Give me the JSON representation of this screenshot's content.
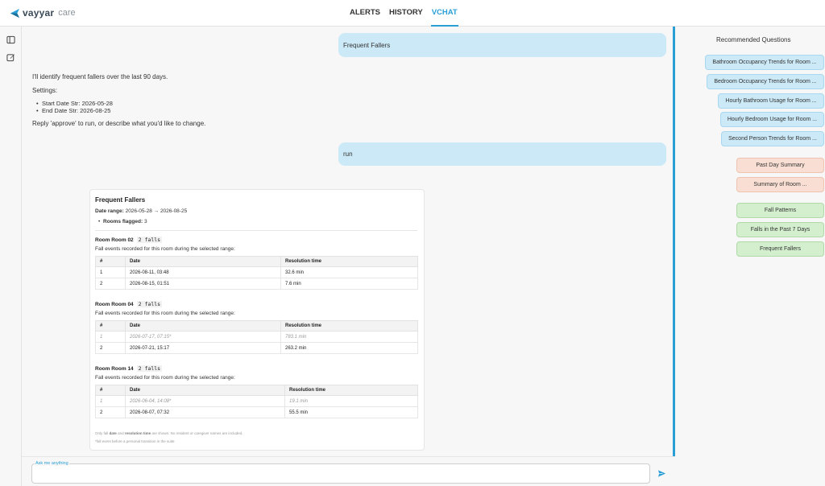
{
  "header": {
    "logo_text": "vayyar",
    "logo_sub": "care",
    "tabs": [
      {
        "label": "ALERTS",
        "active": false
      },
      {
        "label": "HISTORY",
        "active": false
      },
      {
        "label": "VCHAT",
        "active": true
      }
    ],
    "accent_color": "#2a9fd6"
  },
  "left_rail": {
    "icons": [
      "sidebar-toggle-icon",
      "edit-icon"
    ]
  },
  "chat": {
    "user_message_1": "Frequent Fallers",
    "assistant_intro": "I'll identify frequent fallers over the last 90 days.",
    "settings_label": "Settings:",
    "settings_items": [
      "Start Date Str: 2026-05-28",
      "End Date Str: 2026-08-25"
    ],
    "assistant_reply_hint": "Reply 'approve' to run, or describe what you'd like to change.",
    "user_message_2": "run",
    "result": {
      "title": "Frequent Fallers",
      "date_range_label": "Date range:",
      "date_range_value": "2026-05-28 → 2026-08-25",
      "rooms_flagged_label": "Rooms flagged:",
      "rooms_flagged_value": "3",
      "columns": [
        "#",
        "Date",
        "Resolution time"
      ],
      "rooms": [
        {
          "name": "Room Room 02",
          "falls": "2 falls",
          "desc": "Fall events recorded for this room during the selected range:",
          "rows": [
            {
              "n": "1",
              "date": "2026-08-11, 03:48",
              "res": "32.6 min",
              "dim": false
            },
            {
              "n": "2",
              "date": "2026-08-15, 01:51",
              "res": "7.6 min",
              "dim": false
            }
          ]
        },
        {
          "name": "Room Room 04",
          "falls": "2 falls",
          "desc": "Fall events recorded for this room during the selected range:",
          "rows": [
            {
              "n": "1",
              "date": "2026-07-17, 07:15*",
              "res": "783.1 min",
              "dim": true
            },
            {
              "n": "2",
              "date": "2026-07-21, 15:17",
              "res": "263.2 min",
              "dim": false
            }
          ]
        },
        {
          "name": "Room Room 14",
          "falls": "2 falls",
          "desc": "Fall events recorded for this room during the selected range:",
          "rows": [
            {
              "n": "1",
              "date": "2026-06-04, 14:08*",
              "res": "19.1 min",
              "dim": true
            },
            {
              "n": "2",
              "date": "2026-08-07, 07:32",
              "res": "55.5 min",
              "dim": false
            }
          ]
        }
      ],
      "footnote_1_pre": "Only fall",
      "footnote_1_b1": "date",
      "footnote_1_mid": "and",
      "footnote_1_b2": "resolution time",
      "footnote_1_post": "are shown. No resident or caregiver names are included.",
      "footnote_2": "*fall event before a personal transition in the suite"
    }
  },
  "composer": {
    "label": "Ask me anything",
    "value": "",
    "send_icon": "send-icon"
  },
  "recommended": {
    "title": "Recommended Questions",
    "chips": [
      {
        "label": "Bathroom Occupancy Trends for Room ...",
        "color": "blue"
      },
      {
        "label": "Bedroom Occupancy Trends for Room ...",
        "color": "blue"
      },
      {
        "label": "Hourly Bathroom Usage for Room ...",
        "color": "blue"
      },
      {
        "label": "Hourly Bedroom Usage for Room ...",
        "color": "blue"
      },
      {
        "label": "Second Person Trends for Room ...",
        "color": "blue"
      },
      {
        "label": "Past Day Summary",
        "color": "peach"
      },
      {
        "label": "Summary of Room ...",
        "color": "peach"
      },
      {
        "label": "Fall Patterns",
        "color": "green"
      },
      {
        "label": "Falls in the Past 7 Days",
        "color": "green"
      },
      {
        "label": "Frequent Fallers",
        "color": "green"
      }
    ]
  }
}
